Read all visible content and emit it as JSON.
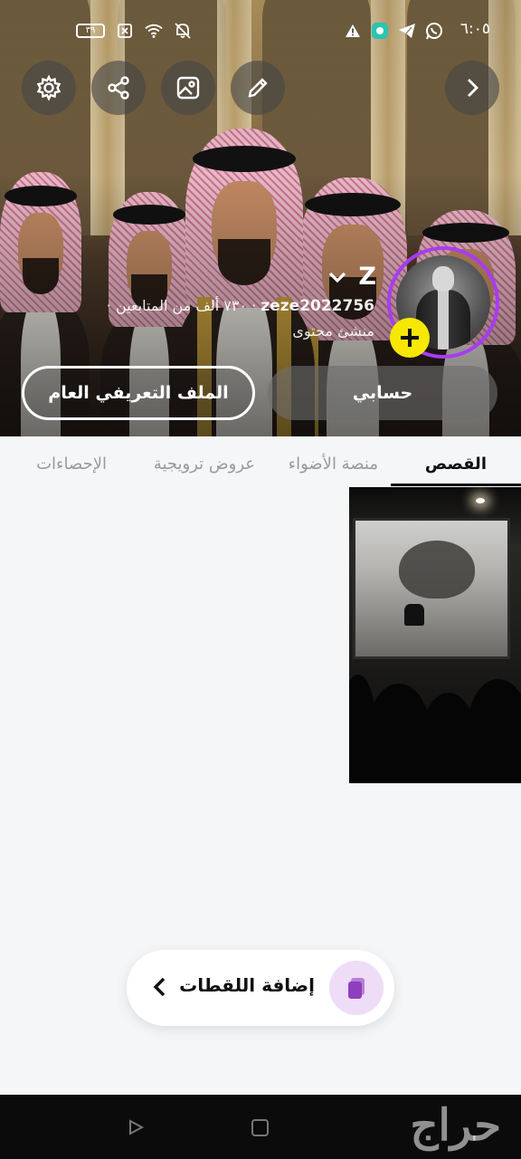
{
  "status_bar": {
    "time": "٦:٠٥",
    "battery": "٣٩",
    "icons_right": [
      "whatsapp-icon",
      "telegram-icon",
      "app-notification-icon",
      "warning-icon"
    ],
    "icons_left": [
      "battery-icon",
      "sim-off-icon",
      "wifi-icon",
      "mute-icon"
    ]
  },
  "header_actions": [
    "back-chevron",
    "edit",
    "change-cover",
    "share",
    "settings"
  ],
  "profile": {
    "display_name": "Z",
    "username": "zeze2022756",
    "followers_text": "٧٣٠ ألف من المتابعين",
    "separator": "·",
    "role": "منشئ محتوى",
    "account_button": "حسابي",
    "public_profile_button": "الملف التعريفي العام",
    "ring_color": "#a83cf0",
    "add_badge_color": "#f6e705"
  },
  "tabs": [
    {
      "label": "القصص",
      "active": true
    },
    {
      "label": "منصة الأضواء",
      "active": false
    },
    {
      "label": "عروض ترويجية",
      "active": false
    },
    {
      "label": "الإحصاءات",
      "active": false
    }
  ],
  "add_snaps": {
    "label": "إضافة اللقطات"
  },
  "watermark": "حراج"
}
